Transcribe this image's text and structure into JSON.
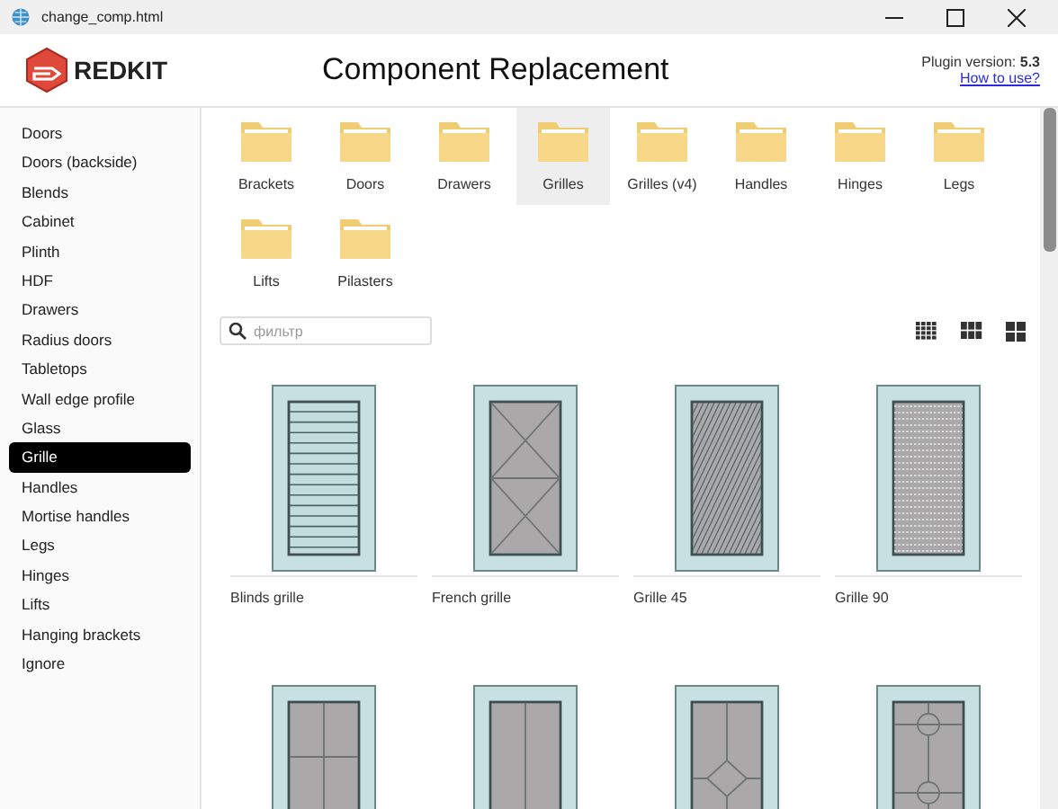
{
  "window": {
    "title": "change_comp.html"
  },
  "header": {
    "logo_text": "REDKIT",
    "title": "Component Replacement",
    "version": "Plugin version: **5.3**",
    "help_link": "How to use?"
  },
  "sidebar": {
    "items": [
      {
        "label": "Doors",
        "selected": false
      },
      {
        "label": "Doors (backside)",
        "selected": false
      },
      {
        "label": "Blends",
        "selected": false
      },
      {
        "label": "Cabinet",
        "selected": false
      },
      {
        "label": "Plinth",
        "selected": false
      },
      {
        "label": "HDF",
        "selected": false
      },
      {
        "label": "Drawers",
        "selected": false
      },
      {
        "label": "Radius doors",
        "selected": false
      },
      {
        "label": "Tabletops",
        "selected": false
      },
      {
        "label": "Wall edge profile",
        "selected": false
      },
      {
        "label": "Glass",
        "selected": false
      },
      {
        "label": "Grille",
        "selected": true
      },
      {
        "label": "Handles",
        "selected": false
      },
      {
        "label": "Mortise handles",
        "selected": false
      },
      {
        "label": "Legs",
        "selected": false
      },
      {
        "label": "Hinges",
        "selected": false
      },
      {
        "label": "Lifts",
        "selected": false
      },
      {
        "label": "Hanging brackets",
        "selected": false
      },
      {
        "label": "Ignore",
        "selected": false
      }
    ]
  },
  "folders": [
    {
      "label": "Brackets",
      "selected": false
    },
    {
      "label": "Doors",
      "selected": false
    },
    {
      "label": "Drawers",
      "selected": false
    },
    {
      "label": "Grilles",
      "selected": true
    },
    {
      "label": "Grilles (v4)",
      "selected": false
    },
    {
      "label": "Handles",
      "selected": false
    },
    {
      "label": "Hinges",
      "selected": false
    },
    {
      "label": "Legs",
      "selected": false
    },
    {
      "label": "Lifts",
      "selected": false
    },
    {
      "label": "Pilasters",
      "selected": false
    }
  ],
  "filter": {
    "placeholder": "фильтр"
  },
  "components": [
    {
      "kind": "blinds",
      "label": "Blinds grille"
    },
    {
      "kind": "french",
      "label": "French grille"
    },
    {
      "kind": "diagonal",
      "label": "Grille 45"
    },
    {
      "kind": "mesh",
      "label": "Grille 90"
    },
    {
      "kind": "cross"
    },
    {
      "kind": "vertical"
    },
    {
      "kind": "diamond"
    },
    {
      "kind": "circles"
    }
  ]
}
